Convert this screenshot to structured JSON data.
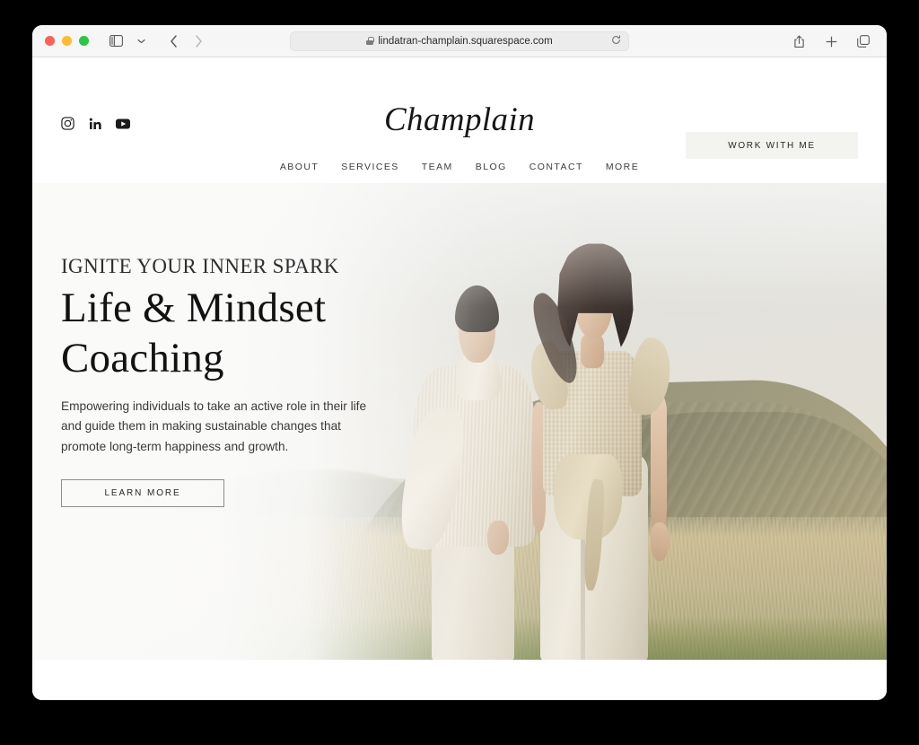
{
  "browser": {
    "url": "lindatran-champlain.squarespace.com",
    "lock_icon": "lock-icon",
    "reload_icon": "reload-icon",
    "sidebar_icon": "sidebar-toggle-icon",
    "tab_overview_chevron": "chevron-down-icon",
    "back_icon": "back-arrow-icon",
    "forward_icon": "forward-arrow-icon",
    "share_icon": "share-icon",
    "new_tab_icon": "plus-icon",
    "tabs_icon": "tabs-overview-icon",
    "window_controls": {
      "close": "#ff5f57",
      "minimize": "#febc2e",
      "zoom": "#28c840"
    }
  },
  "site": {
    "brand": "Champlain",
    "socials": [
      {
        "name": "instagram",
        "label": "Instagram"
      },
      {
        "name": "linkedin",
        "label": "LinkedIn"
      },
      {
        "name": "youtube",
        "label": "YouTube"
      }
    ],
    "nav": [
      {
        "label": "ABOUT"
      },
      {
        "label": "SERVICES"
      },
      {
        "label": "TEAM"
      },
      {
        "label": "BLOG"
      },
      {
        "label": "CONTACT"
      },
      {
        "label": "MORE"
      }
    ],
    "header_cta": "WORK WITH ME"
  },
  "hero": {
    "eyebrow": "IGNITE YOUR INNER SPARK",
    "headline_line1": "Life & Mindset",
    "headline_line2": "Coaching",
    "body": "Empowering individuals to take an active role in their life and guide them in making sustainable changes that promote long-term happiness and growth.",
    "cta": "LEARN MORE",
    "image_alt": "two-women-in-cream-knitwear-standing-in-misty-mountain-field"
  },
  "colors": {
    "page_background": "#ffffff",
    "header_cta_background": "#f3f3ef",
    "headline_text": "#121212",
    "body_text": "#3a3a3a",
    "nav_text": "#3d3d3d",
    "button_border": "#8d8d8d",
    "toolbar_background": "#f6f6f6",
    "url_field_background": "#ececec"
  }
}
